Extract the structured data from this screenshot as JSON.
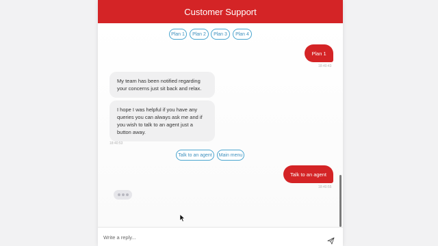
{
  "header": {
    "title": "Customer Support"
  },
  "plan_chips": [
    "Plan 1",
    "Plan 2",
    "Plan 3",
    "Plan 4"
  ],
  "messages": {
    "user_1": {
      "text": "Plan 1",
      "time": "18:40:43"
    },
    "bot_1": "My team has been notified regarding your concerns just sit back and relax.",
    "bot_2": "I hope I was helpful if you have any queries you can always ask me and if you wish to talk to an agent just a button away.",
    "bot_time": "18:40:53",
    "user_2": {
      "text": "Talk to an agent",
      "time": "18:40:55"
    }
  },
  "quick_replies": {
    "agent": "Talk to an agent",
    "menu": "Main menu"
  },
  "composer": {
    "placeholder": "Write a reply..."
  },
  "icons": {
    "send": "send-icon",
    "typing": "typing-indicator",
    "cursor": "mouse-pointer"
  },
  "colors": {
    "brand": "#d42426",
    "chip_border": "#47a4cf",
    "bot_bubble": "#f0f0f1"
  }
}
